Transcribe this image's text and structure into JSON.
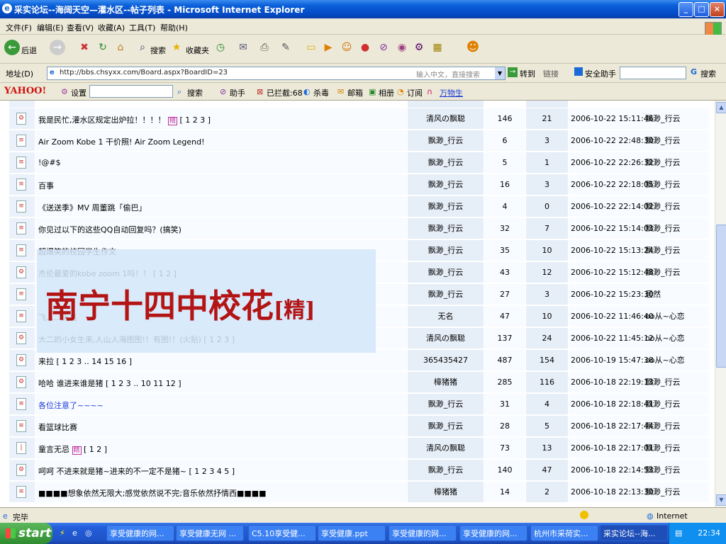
{
  "window": {
    "title": "采实论坛--海阔天空—灌水区--帖子列表 - Microsoft Internet Explorer",
    "ie_icon": "e"
  },
  "menu": [
    "文件(F)",
    "编辑(E)",
    "查看(V)",
    "收藏(A)",
    "工具(T)",
    "帮助(H)"
  ],
  "toolbar": {
    "back": "后退",
    "search": "搜索",
    "favorites": "收藏夹"
  },
  "address": {
    "label": "地址(D)",
    "url": "http://bbs.chsyxx.com/Board.aspx?BoardID=23",
    "hint": "输入中文，直接搜索",
    "go": "转到",
    "links": "链接",
    "safety": "安全助手",
    "search_btn": "搜索"
  },
  "yahoo": {
    "logo": "YAHOO!",
    "settings": "设置",
    "search": "搜索",
    "helper": "助手",
    "blocked": "已拦截:68",
    "sound": "杀毒",
    "mail": "邮箱",
    "photo": "相册",
    "rss": "订阅",
    "wanwu": "万物生"
  },
  "rows": [
    {
      "icon": "hot",
      "title": "我是民忙,灌水区规定出炉拉！！！！",
      "tag": "精",
      "pages": "[ 1 2 3 ]",
      "author": "清风の飘聪",
      "replies": "146",
      "views": "21",
      "last_time": "2006-10-22 15:11:46",
      "last_user": "飘渺_行云"
    },
    {
      "icon": "doc",
      "title": "Air Zoom Kobe 1 干价照! Air Zoom Legend!",
      "tag": "",
      "pages": "",
      "author": "飘渺_行云",
      "replies": "6",
      "views": "3",
      "last_time": "2006-10-22 22:48:30",
      "last_user": "飘渺_行云"
    },
    {
      "icon": "doc",
      "title": "!@#$",
      "tag": "",
      "pages": "",
      "author": "飘渺_行云",
      "replies": "5",
      "views": "1",
      "last_time": "2006-10-22 22:26:32",
      "last_user": "飘渺_行云"
    },
    {
      "icon": "doc",
      "title": "百事",
      "tag": "",
      "pages": "",
      "author": "飘渺_行云",
      "replies": "16",
      "views": "3",
      "last_time": "2006-10-22 22:18:05",
      "last_user": "飘渺_行云"
    },
    {
      "icon": "doc",
      "title": "《送送季》MV 周董跳「偷巴」",
      "tag": "",
      "pages": "",
      "author": "飘渺_行云",
      "replies": "4",
      "views": "0",
      "last_time": "2006-10-22 22:14:02",
      "last_user": "飘渺_行云"
    },
    {
      "icon": "doc",
      "title": "你见过以下的这些QQ自动回复吗？(搞笑)",
      "tag": "",
      "pages": "",
      "author": "飘渺_行云",
      "replies": "32",
      "views": "7",
      "last_time": "2006-10-22 15:14:03",
      "last_user": "飘渺_行云"
    },
    {
      "icon": "doc",
      "title": "超爆笑的校园学生作文",
      "tag": "",
      "pages": "",
      "author": "飘渺_行云",
      "replies": "35",
      "views": "10",
      "last_time": "2006-10-22 15:13:24",
      "last_user": "飘渺_行云"
    },
    {
      "icon": "hot",
      "title": "杰伦最爱的kobe zoom 1吗！！",
      "tag": "",
      "pages": "[ 1 2 ]",
      "author": "飘渺_行云",
      "replies": "43",
      "views": "12",
      "last_time": "2006-10-22 15:12:48",
      "last_user": "飘渺_行云"
    },
    {
      "icon": "doc",
      "title": "",
      "tag": "",
      "pages": "",
      "author": "飘渺_行云",
      "replies": "27",
      "views": "3",
      "last_time": "2006-10-22 15:23:30",
      "last_user": "居然"
    },
    {
      "icon": "doc",
      "title": "飞……无名",
      "tag": "",
      "pages": "",
      "author": "无名",
      "replies": "47",
      "views": "10",
      "last_time": "2006-10-22 11:46:40",
      "last_user": "oo从~心恋"
    },
    {
      "icon": "hot",
      "title": "大二的小女生来,人山人海图图!！有图!！(火贴)",
      "tag": "",
      "pages": "[ 1 2 3 ]",
      "author": "清风の飘聪",
      "replies": "137",
      "views": "24",
      "last_time": "2006-10-22 11:45:12",
      "last_user": "oo从~心恋"
    },
    {
      "icon": "hot",
      "title": "来拉",
      "tag": "",
      "pages": "[ 1 2 3 .. 14 15 16 ]",
      "author": "365435427",
      "replies": "487",
      "views": "154",
      "last_time": "2006-10-19 15:47:38",
      "last_user": "oo从~心恋"
    },
    {
      "icon": "hot",
      "title": "哈哈   谁进来谁是猪",
      "tag": "",
      "pages": "[ 1 2 3 .. 10 11 12 ]",
      "author": "樟猪猪",
      "replies": "285",
      "views": "116",
      "last_time": "2006-10-18 22:19:13",
      "last_user": "飘渺_行云"
    },
    {
      "icon": "doc",
      "title": "各位注意了~~~~",
      "tag": "",
      "pages": "",
      "author": "飘渺_行云",
      "replies": "31",
      "views": "4",
      "last_time": "2006-10-18 22:18:41",
      "last_user": "飘渺_行云",
      "link": true
    },
    {
      "icon": "doc",
      "title": "看篮球比赛",
      "tag": "",
      "pages": "",
      "author": "飘渺_行云",
      "replies": "28",
      "views": "5",
      "last_time": "2006-10-18 22:17:44",
      "last_user": "飘渺_行云"
    },
    {
      "icon": "vote",
      "title": "童言无忌",
      "tag": "精",
      "pages": "[ 1 2 ]",
      "author": "清风の飘聪",
      "replies": "73",
      "views": "13",
      "last_time": "2006-10-18 22:17:01",
      "last_user": "飘渺_行云"
    },
    {
      "icon": "hot",
      "title": "呵呵 不进来就是猪~进来的不一定不是猪~",
      "tag": "",
      "pages": "[ 1 2 3 4 5 ]",
      "author": "飘渺_行云",
      "replies": "140",
      "views": "47",
      "last_time": "2006-10-18 22:14:53",
      "last_user": "飘渺_行云"
    },
    {
      "icon": "doc",
      "title": "■■■■想象依然无限大;感觉依然说不完;音乐依然抒情西■■■■",
      "tag": "",
      "pages": "",
      "author": "樟猪猪",
      "replies": "14",
      "views": "2",
      "last_time": "2006-10-18 22:13:30",
      "last_user": "飘渺_行云"
    }
  ],
  "overlay": {
    "main": "南宁十四中校花",
    "tag": "[精]"
  },
  "status": {
    "text": "完毕",
    "zone": "Internet"
  },
  "taskbar": {
    "start": "start",
    "tasks": [
      "享受健康的网...",
      "享受健康无网 ...",
      "C5.10享受健...",
      "享受健康.ppt",
      "享受健康的网...",
      "享受健康的网...",
      "杭州市采荷实...",
      "采实论坛--海..."
    ],
    "clock": "22:34"
  }
}
